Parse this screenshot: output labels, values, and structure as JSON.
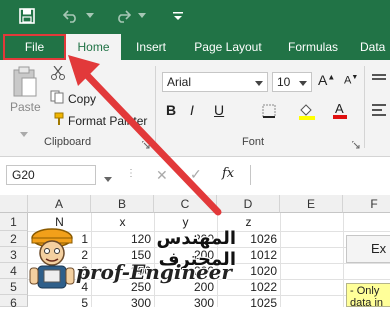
{
  "ribbon_tabs": {
    "file": "File",
    "home": "Home",
    "insert": "Insert",
    "page_layout": "Page Layout",
    "formulas": "Formulas",
    "data": "Data"
  },
  "clipboard": {
    "paste": "Paste",
    "copy": "Copy",
    "format_painter": "Format Painter",
    "group_label": "Clipboard"
  },
  "font": {
    "name": "Arial",
    "size": "10",
    "bold": "B",
    "italic": "I",
    "underline": "U",
    "group_label": "Font"
  },
  "formula_bar": {
    "cell_ref": "G20",
    "fx": "fx"
  },
  "columns": [
    "A",
    "B",
    "C",
    "D",
    "E",
    "F"
  ],
  "rows": [
    "1",
    "2",
    "3",
    "4",
    "5",
    "6"
  ],
  "cells": {
    "A1": "N",
    "B1": "x",
    "C1": "y",
    "D1": "z",
    "A2": "1",
    "B2": "120",
    "C2": "200",
    "D2": "1026",
    "A3": "2",
    "B3": "150",
    "C3": "200",
    "D3": "1012",
    "A4": "3",
    "B4": "200",
    "C4": "200",
    "D4": "1020",
    "A5": "4",
    "B5": "250",
    "C5": "200",
    "D5": "1022",
    "A6": "5",
    "B6": "300",
    "C6": "300",
    "D6": "1025"
  },
  "side_button": "Ex",
  "note_text_1": "- Only",
  "note_text_2": "data in",
  "watermark": {
    "arabic": "المهندس المحترف",
    "latin": "prof-Engineer"
  },
  "colors": {
    "excel_green": "#217346",
    "arrow_red": "#e2393a",
    "note_yellow": "#ffff99"
  }
}
